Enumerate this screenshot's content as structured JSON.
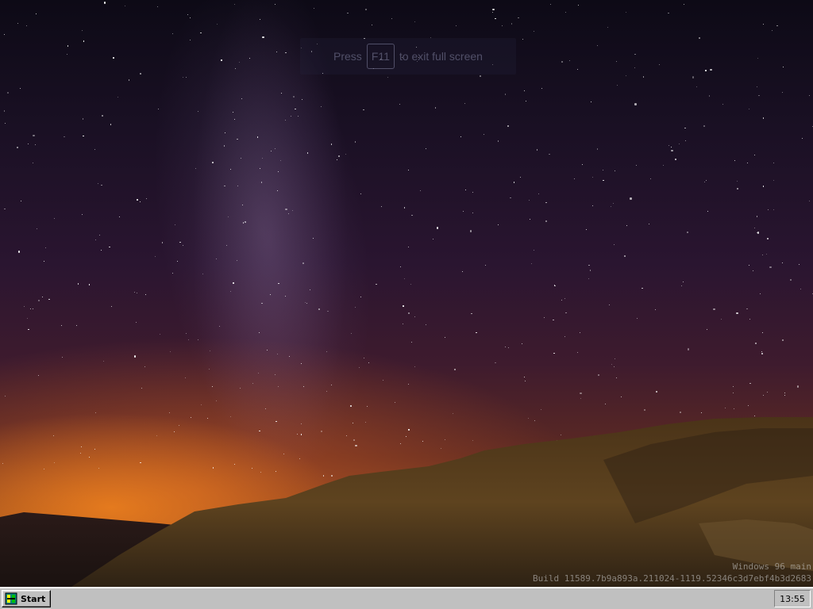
{
  "desktop": {
    "wallpaper": "night-sky-milky-way-over-hills",
    "fullscreen_hint": {
      "prefix": "Press",
      "key": "F11",
      "suffix": "to exit full screen"
    },
    "build_info": {
      "line1": "Windows 96 main",
      "line2": "Build 11589.7b9a893a.211024-1119.52346c3d7ebf4b3d2683"
    }
  },
  "taskbar": {
    "start_label": "Start",
    "start_icon": "windows-96-logo-icon",
    "clock": "13:55",
    "colors": {
      "face": "#c0c0c0",
      "highlight": "#ffffff",
      "shadow": "#808080"
    }
  }
}
